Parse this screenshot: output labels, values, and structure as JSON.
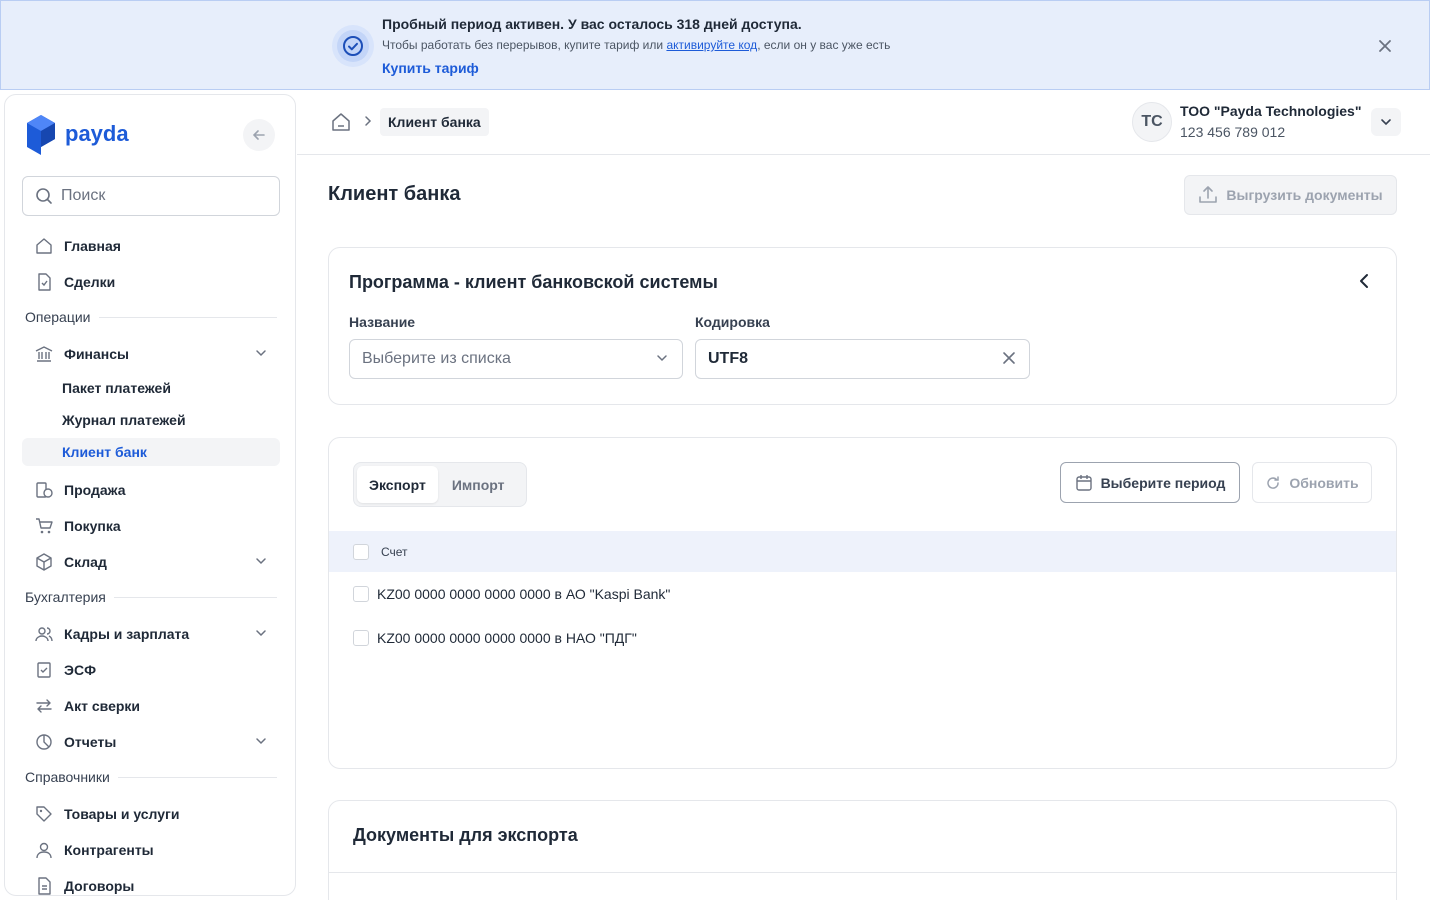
{
  "banner": {
    "title": "Пробный период активен. У вас осталось 318 дней доступа.",
    "text_before": "Чтобы работать без перерывов, купите тариф или ",
    "text_link": "активируйте код",
    "text_after": ", если он у вас уже есть",
    "buy_link": "Купить тариф",
    "accent_color": "#1d5bd8"
  },
  "sidebar": {
    "logo_text": "payda",
    "search_placeholder": "Поиск",
    "items": [
      {
        "label": "Главная",
        "icon": "home-icon"
      },
      {
        "label": "Сделки",
        "icon": "document-check-icon"
      },
      {
        "section": "Операции"
      },
      {
        "label": "Финансы",
        "icon": "bank-icon",
        "expandable": true
      },
      {
        "sub": "Пакет платежей"
      },
      {
        "sub": "Журнал платежей"
      },
      {
        "sub": "Клиент банк",
        "active": true
      },
      {
        "label": "Продажа",
        "icon": "coins-icon"
      },
      {
        "label": "Покупка",
        "icon": "cart-icon"
      },
      {
        "label": "Склад",
        "icon": "box-icon",
        "expandable": true
      },
      {
        "section": "Бухгалтерия"
      },
      {
        "label": "Кадры и зарплата",
        "icon": "users-icon",
        "expandable": true
      },
      {
        "label": "ЭСФ",
        "icon": "invoice-icon"
      },
      {
        "label": "Акт сверки",
        "icon": "arrows-icon"
      },
      {
        "label": "Отчеты",
        "icon": "pie-chart-icon",
        "expandable": true
      },
      {
        "section": "Справочники"
      },
      {
        "label": "Товары и услуги",
        "icon": "tag-icon"
      },
      {
        "label": "Контрагенты",
        "icon": "user-icon"
      },
      {
        "label": "Договоры",
        "icon": "contract-icon"
      }
    ]
  },
  "header": {
    "breadcrumb": "Клиент банка",
    "avatar_initials": "TC",
    "org_name": "ТОО \"Payda Technologies\"",
    "org_id": "123 456 789 012"
  },
  "main": {
    "title": "Клиент банка",
    "export_button": "Выгрузить документы",
    "program_card": {
      "title": "Программа - клиент банковской системы",
      "name_label": "Название",
      "name_placeholder": "Выберите из списка",
      "encoding_label": "Кодировка",
      "encoding_value": "UTF8"
    },
    "accounts_card": {
      "tabs": [
        "Экспорт",
        "Импорт"
      ],
      "active_tab": "Экспорт",
      "period_button": "Выберите период",
      "refresh_button": "Обновить",
      "column_header": "Счет",
      "rows": [
        "KZ00 0000 0000 0000 0000 в АО \"Kaspi Bank\"",
        "KZ00 0000 0000 0000 0000 в НАО \"ПДГ\""
      ]
    },
    "documents_card": {
      "title": "Документы для экспорта"
    }
  }
}
